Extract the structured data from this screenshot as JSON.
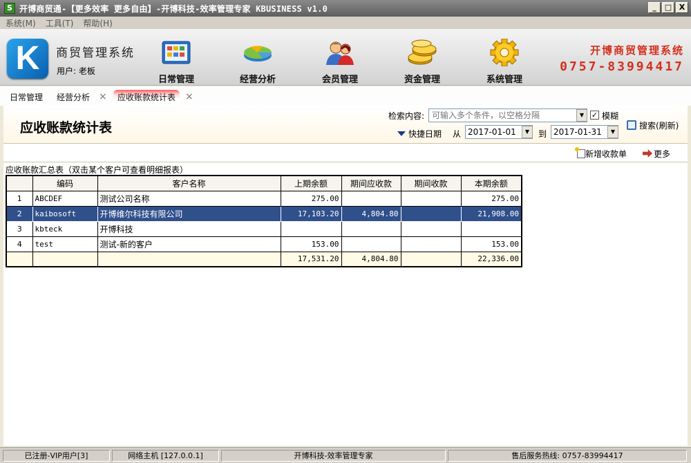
{
  "window": {
    "title": "开博商贸通-【更多效率 更多自由】-开博科技-效率管理专家  KBUSINESS v1.0",
    "app_icon": "S",
    "buttons": [
      "_",
      "□",
      "X"
    ]
  },
  "menu": [
    "系统(M)",
    "工具(T)",
    "帮助(H)"
  ],
  "header": {
    "logo_letter": "K",
    "app_name": "商贸管理系统",
    "user_label": "用户: 老板",
    "nav": [
      {
        "label": "日常管理",
        "icon": "daily-management-icon"
      },
      {
        "label": "经营分析",
        "icon": "business-analysis-icon"
      },
      {
        "label": "会员管理",
        "icon": "member-management-icon"
      },
      {
        "label": "资金管理",
        "icon": "fund-management-icon"
      },
      {
        "label": "系统管理",
        "icon": "system-management-icon"
      }
    ],
    "brand_name": "开博商贸管理系统",
    "brand_phone": "0757-83994417",
    "brand_color": "#d4301e"
  },
  "tabs": [
    {
      "label": "日常管理",
      "closable": false
    },
    {
      "label": "经营分析",
      "closable": true
    },
    {
      "label": "应收账款统计表",
      "closable": true,
      "active": true
    }
  ],
  "page": {
    "title": "应收账款统计表",
    "search_label": "检索内容:",
    "search_placeholder": "可输入多个条件，以空格分隔",
    "fuzzy_label": "模糊",
    "fuzzy_checked": "✓",
    "search_button": "搜索(刷新)",
    "quick_date_label": "快捷日期",
    "from_label": "从",
    "from_date": "2017-01-01",
    "to_label": "到",
    "to_date": "2017-01-31",
    "add_button": "新增收款单",
    "more_button": "更多",
    "summary_caption": "应收账款汇总表（双击某个客户可查看明细报表）"
  },
  "table": {
    "headers": [
      "",
      "编码",
      "客户名称",
      "上期余额",
      "期间应收款",
      "期间收款",
      "本期余额"
    ],
    "rows": [
      {
        "idx": "1",
        "code": "ABCDEF",
        "name": "测试公司名称",
        "prev": "275.00",
        "receivable": "",
        "received": "",
        "balance": "275.00"
      },
      {
        "idx": "2",
        "code": "kaibosoft",
        "name": "开博维尔科技有限公司",
        "prev": "17,103.20",
        "receivable": "4,804.80",
        "received": "",
        "balance": "21,908.00"
      },
      {
        "idx": "3",
        "code": "kbteck",
        "name": "开博科技",
        "prev": "",
        "receivable": "",
        "received": "",
        "balance": ""
      },
      {
        "idx": "4",
        "code": "test",
        "name": "测试-新的客户",
        "prev": "153.00",
        "receivable": "",
        "received": "",
        "balance": "153.00"
      }
    ],
    "selected_row": 2,
    "totals": {
      "prev": "17,531.20",
      "receivable": "4,804.80",
      "received": "",
      "balance": "22,336.00"
    }
  },
  "status": {
    "registration": "已注册-VIP用户[3]",
    "host": "网络主机 [127.0.0.1]",
    "slogan": "开博科技-效率管理专家",
    "hotline": "售后服务热线: 0757-83994417"
  }
}
